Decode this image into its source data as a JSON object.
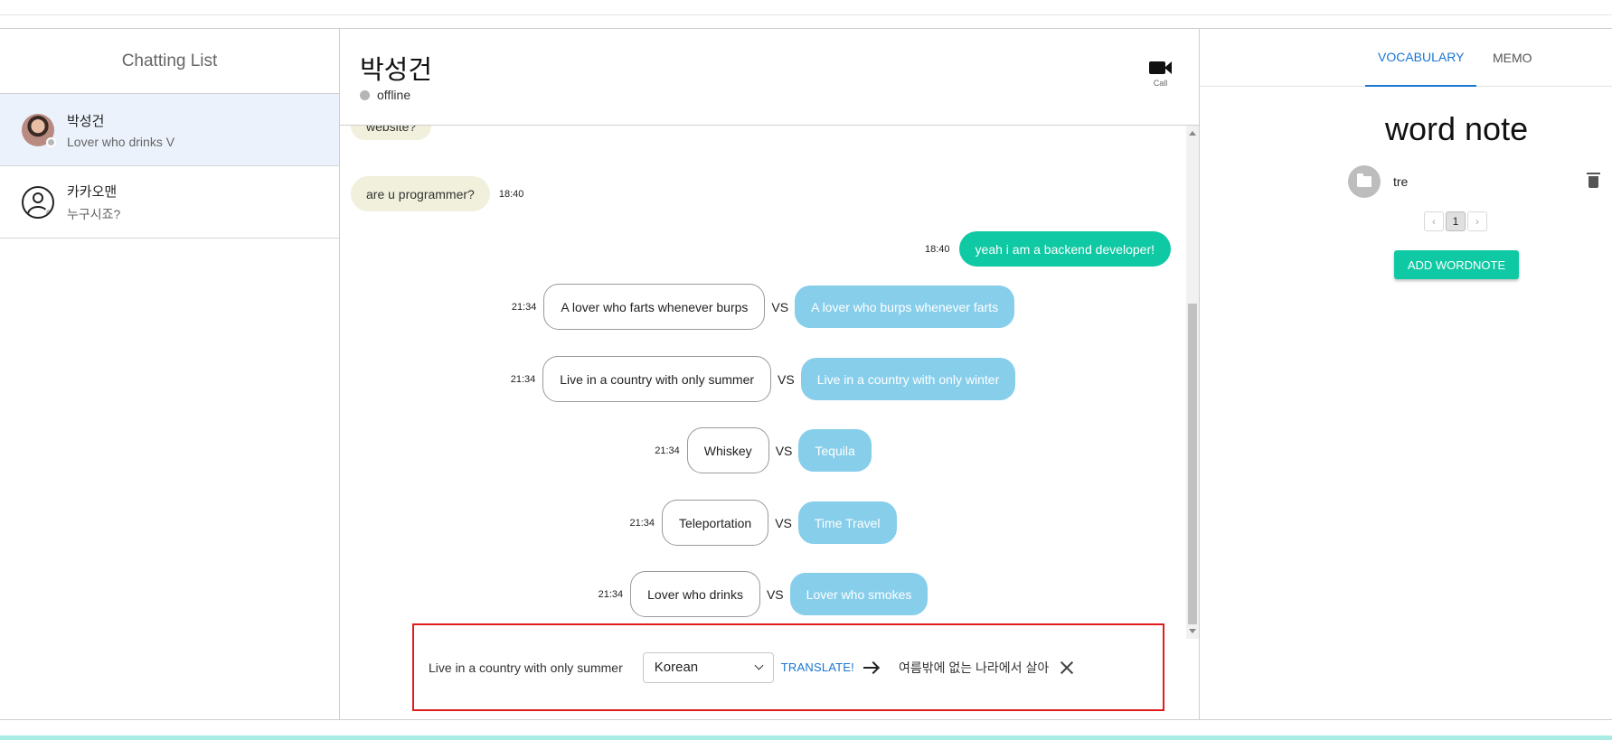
{
  "left": {
    "title": "Chatting List",
    "chats": [
      {
        "name": "박성건",
        "preview": "Lover who drinks V"
      },
      {
        "name": "카카오맨",
        "preview": "누구시죠?"
      }
    ]
  },
  "chat": {
    "peer_name": "박성건",
    "peer_status": "offline",
    "call_label": "Call",
    "partial_message": "website?",
    "messages": [
      {
        "text": "are u programmer?",
        "time": "18:40"
      },
      {
        "text": "yeah i am a backend developer!",
        "time": "18:40"
      }
    ],
    "vs_label": "VS",
    "polls": [
      {
        "time": "21:34",
        "a": "A lover who farts whenever burps",
        "b": "A lover who burps whenever farts"
      },
      {
        "time": "21:34",
        "a": "Live in a country with only summer",
        "b": "Live in a country with only winter"
      },
      {
        "time": "21:34",
        "a": "Whiskey",
        "b": "Tequila"
      },
      {
        "time": "21:34",
        "a": "Teleportation",
        "b": "Time Travel"
      },
      {
        "time": "21:34",
        "a": "Lover who drinks",
        "b": "Lover who smokes"
      }
    ]
  },
  "translate": {
    "source_text": "Live in a country with only summer",
    "language": "Korean",
    "button_label": "TRANSLATE!",
    "result_text": "여름밖에 없는 나라에서 살아"
  },
  "right": {
    "tabs": [
      "VOCABULARY",
      "MEMO"
    ],
    "title": "word note",
    "folder_name": "tre",
    "current_page": "1",
    "prev_glyph": "‹",
    "next_glyph": "›",
    "add_button": "ADD WORDNOTE"
  },
  "colors": {
    "accent_green": "#0fc9a4",
    "option_blue": "#87ceeb",
    "link_blue": "#1976d2",
    "highlight_red": "#e01c1c"
  }
}
